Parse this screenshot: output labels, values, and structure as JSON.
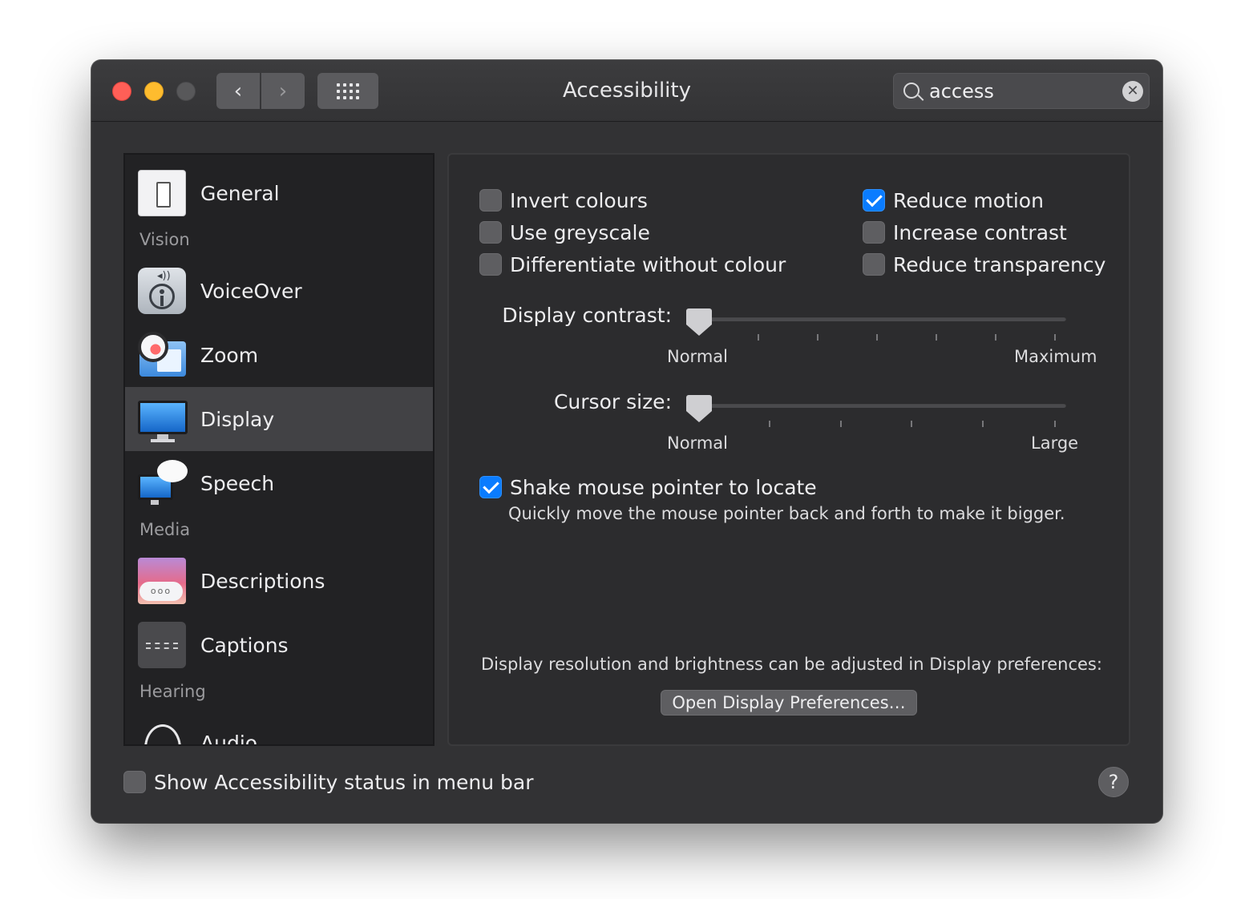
{
  "window": {
    "title": "Accessibility",
    "back_glyph": "‹",
    "forward_glyph": "›"
  },
  "search": {
    "value": "access",
    "clear_glyph": "✕"
  },
  "sidebar": {
    "items": [
      {
        "label": "General",
        "icon": "general-icon"
      },
      {
        "header": "Vision"
      },
      {
        "label": "VoiceOver",
        "icon": "voiceover-icon"
      },
      {
        "label": "Zoom",
        "icon": "zoom-icon"
      },
      {
        "label": "Display",
        "icon": "display-icon",
        "selected": true
      },
      {
        "label": "Speech",
        "icon": "speech-icon"
      },
      {
        "header": "Media"
      },
      {
        "label": "Descriptions",
        "icon": "descriptions-icon"
      },
      {
        "label": "Captions",
        "icon": "captions-icon"
      },
      {
        "header": "Hearing"
      },
      {
        "label": "Audio",
        "icon": "audio-icon"
      }
    ],
    "desc_bubble": "ooo"
  },
  "display": {
    "options_left": [
      {
        "label": "Invert colours",
        "checked": false
      },
      {
        "label": "Use greyscale",
        "checked": false
      },
      {
        "label": "Differentiate without colour",
        "checked": false
      }
    ],
    "options_right": [
      {
        "label": "Reduce motion",
        "checked": true
      },
      {
        "label": "Increase contrast",
        "checked": false
      },
      {
        "label": "Reduce transparency",
        "checked": false
      }
    ],
    "contrast_slider": {
      "label": "Display contrast:",
      "min_label": "Normal",
      "max_label": "Maximum",
      "value": 0
    },
    "cursor_slider": {
      "label": "Cursor size:",
      "min_label": "Normal",
      "max_label": "Large",
      "value": 0
    },
    "shake": {
      "label": "Shake mouse pointer to locate",
      "checked": true,
      "description": "Quickly move the mouse pointer back and forth to make it bigger."
    },
    "resolution_note": "Display resolution and brightness can be adjusted in Display preferences:",
    "open_button": "Open Display Preferences…"
  },
  "footer": {
    "status_label": "Show Accessibility status in menu bar",
    "status_checked": false,
    "help_glyph": "?"
  },
  "colors": {
    "accent": "#0a7cff",
    "close": "#ff5f57",
    "minimize": "#febc2e"
  }
}
